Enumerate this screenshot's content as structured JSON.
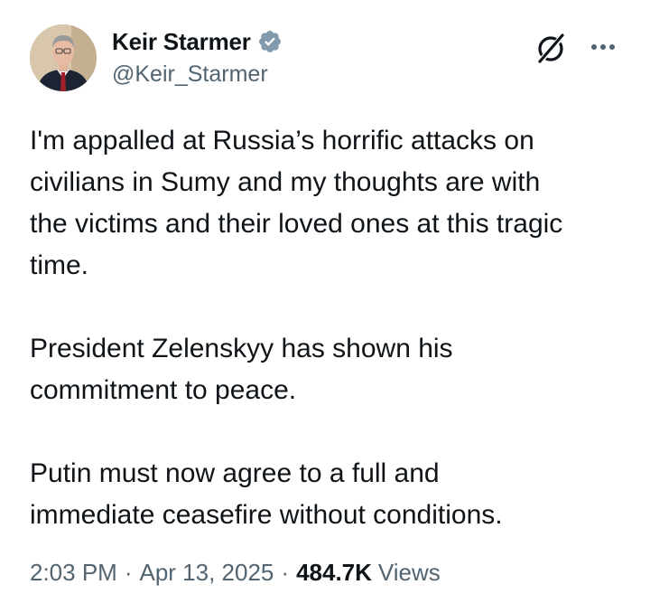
{
  "author": {
    "display_name": "Keir Starmer",
    "handle": "@Keir_Starmer",
    "verified_color": "#829aab",
    "avatar_icon": "profile-photo"
  },
  "actions": {
    "grok_icon": "grok-icon",
    "more_icon": "more-options-icon"
  },
  "tweet": {
    "paragraphs": [
      "I'm appalled at Russia’s horrific attacks on\ncivilians in Sumy and my thoughts are with\nthe victims and their loved ones at this tragic\ntime.",
      "President Zelenskyy has shown his\ncommitment to peace.",
      "Putin must now agree to a full and\nimmediate ceasefire without conditions."
    ]
  },
  "meta": {
    "time": "2:03 PM",
    "separator": "·",
    "date": "Apr 13, 2025",
    "views_count": "484.7K",
    "views_label": "Views"
  },
  "colors": {
    "text_primary": "#0f1419",
    "text_secondary": "#536471"
  }
}
